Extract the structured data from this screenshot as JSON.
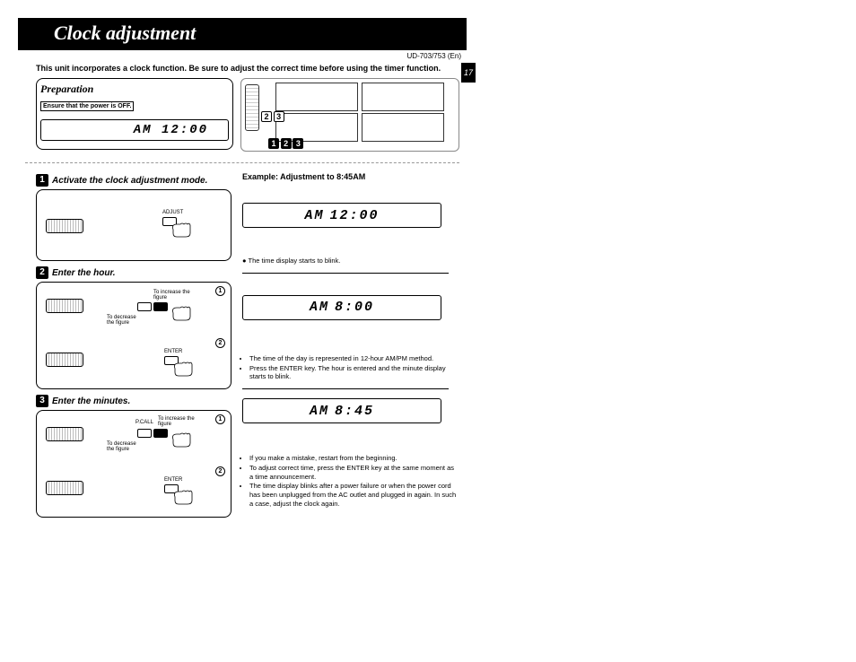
{
  "header": {
    "title": "Clock adjustment",
    "model_id": "UD-703/753 (En)",
    "page_tab": "17"
  },
  "intro": "This unit incorporates a clock function. Be sure to adjust the correct time before using the timer function.",
  "preparation": {
    "title": "Preparation",
    "ensure": "Ensure that the power is OFF.",
    "display": "AM 12:00"
  },
  "equipment": {
    "callouts_top": [
      "2",
      "3"
    ],
    "callouts_bottom": [
      "1",
      "2",
      "3"
    ]
  },
  "steps": [
    {
      "num": "1",
      "title": "Activate the clock adjustment mode.",
      "diagram": {
        "btn_label": "ADJUST"
      }
    },
    {
      "num": "2",
      "title": "Enter the hour.",
      "diagram": {
        "inc": "To increase the figure",
        "dec": "To decrease the figure",
        "btn_label": "ENTER",
        "sub1": "1",
        "sub2": "2"
      }
    },
    {
      "num": "3",
      "title": "Enter the minutes.",
      "diagram": {
        "inc": "To increase the figure",
        "dec": "To decrease the figure",
        "btn_label": "ENTER",
        "sub1": "1",
        "sub2": "2",
        "pcall": "P.CALL"
      }
    }
  ],
  "example": {
    "title": "Example: Adjustment to 8:45AM",
    "display1": {
      "ampm": "AM",
      "time": "12:00"
    },
    "note1": "The time display starts to blink.",
    "display2": {
      "ampm": "AM",
      "time": "8:00"
    },
    "notes2": [
      "The time of the day is represented in 12-hour AM/PM method.",
      "Press the ENTER key. The hour is entered and the minute display starts to blink."
    ],
    "display3": {
      "ampm": "AM",
      "time": "8:45"
    },
    "notes3": [
      "If you make a mistake, restart from the beginning.",
      "To adjust correct time, press the ENTER key at the same moment as a time announcement.",
      "The time display blinks after a power failure or when the power cord has been unplugged from the AC outlet and plugged in again. In such a case, adjust the clock again."
    ]
  }
}
